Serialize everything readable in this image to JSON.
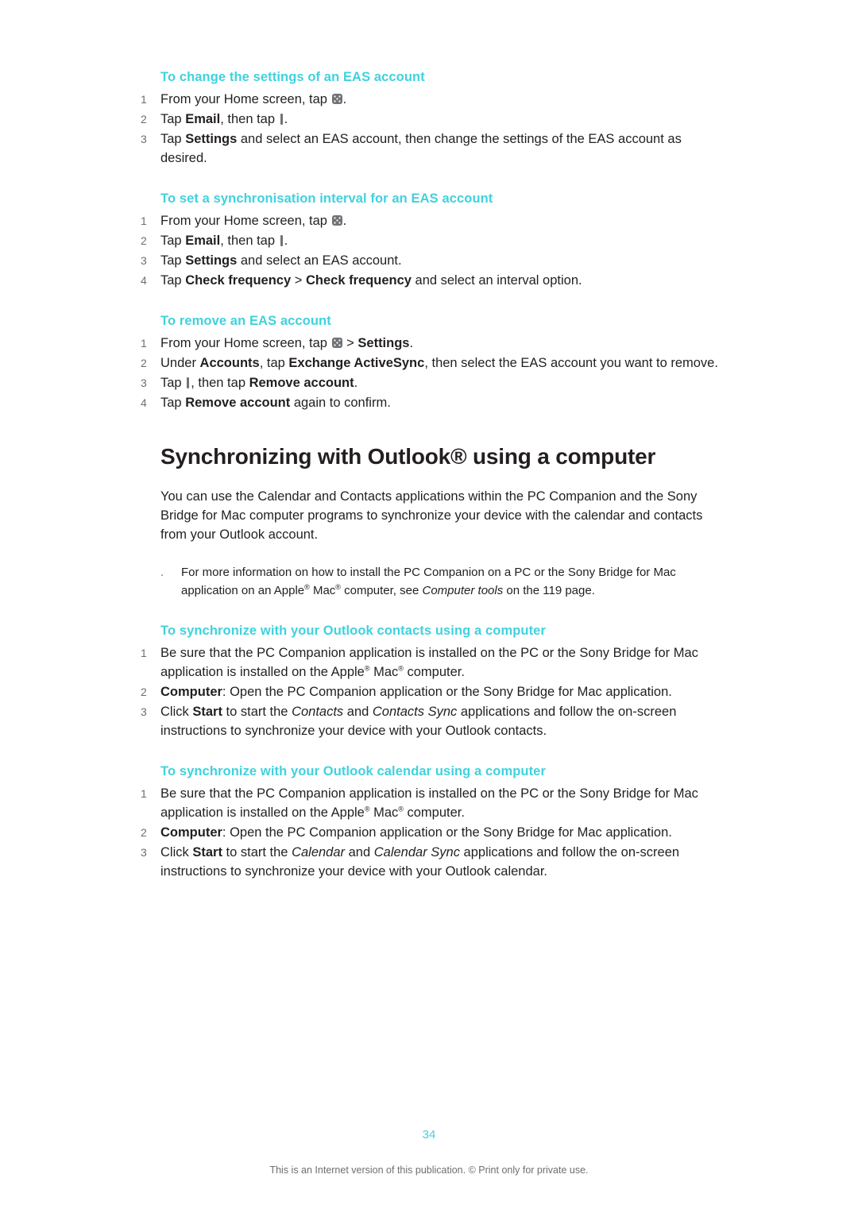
{
  "page": {
    "number": "34",
    "footer": "This is an Internet version of this publication. © Print only for private use."
  },
  "sections": [
    {
      "heading": "To change the settings of an EAS account",
      "steps": [
        {
          "num": "1",
          "html": "From your Home screen, tap <span class=\"icon-apps\" data-name=\"apps-icon\" data-interactable=\"false\"></span>."
        },
        {
          "num": "2",
          "html": "Tap <b>Email</b>, then tap <span class=\"icon-menu\" data-name=\"options-menu-icon\" data-interactable=\"false\"></span>."
        },
        {
          "num": "3",
          "html": "Tap <b>Settings</b> and select an EAS account, then change the settings of the EAS account as desired."
        }
      ]
    },
    {
      "heading": "To set a synchronisation interval for an EAS account",
      "steps": [
        {
          "num": "1",
          "html": "From your Home screen, tap <span class=\"icon-apps\" data-name=\"apps-icon\" data-interactable=\"false\"></span>."
        },
        {
          "num": "2",
          "html": "Tap <b>Email</b>, then tap <span class=\"icon-menu\" data-name=\"options-menu-icon\" data-interactable=\"false\"></span>."
        },
        {
          "num": "3",
          "html": "Tap <b>Settings</b> and select an EAS account."
        },
        {
          "num": "4",
          "html": "Tap <b>Check frequency</b> &gt; <b>Check frequency</b> and select an interval option."
        }
      ]
    },
    {
      "heading": "To remove an EAS account",
      "steps": [
        {
          "num": "1",
          "html": "From your Home screen, tap <span class=\"icon-apps\" data-name=\"apps-icon\" data-interactable=\"false\"></span> &gt; <b>Settings</b>."
        },
        {
          "num": "2",
          "html": "Under <b>Accounts</b>, tap <b>Exchange ActiveSync</b>, then select the EAS account you want to remove."
        },
        {
          "num": "3",
          "html": "Tap <span class=\"icon-menu\" data-name=\"options-menu-icon\" data-interactable=\"false\"></span>, then tap <b>Remove account</b>."
        },
        {
          "num": "4",
          "html": "Tap <b>Remove account</b> again to confirm."
        }
      ]
    }
  ],
  "main": {
    "title": "Synchronizing with Outlook® using a computer",
    "intro": "You can use the Calendar and Contacts applications within the PC Companion and the Sony Bridge for Mac computer programs to synchronize your device with the calendar and contacts from your Outlook account.",
    "note_html": "For more information on how to install the PC Companion on a PC or the Sony Bridge for Mac application on an Apple<sup>®</sup> Mac<sup>®</sup> computer, see <i>Computer tools</i> on the 119 page.",
    "note_bullet": "."
  },
  "sections2": [
    {
      "heading": "To synchronize with your Outlook contacts using a computer",
      "steps": [
        {
          "num": "1",
          "html": "Be sure that the PC Companion application is installed on the PC or the Sony Bridge for Mac application is installed on the Apple<sup>®</sup> Mac<sup>®</sup> computer."
        },
        {
          "num": "2",
          "html": "<b>Computer</b>: Open the PC Companion application or the Sony Bridge for Mac application."
        },
        {
          "num": "3",
          "html": "Click <b>Start</b> to start the <i>Contacts</i> and <i>Contacts Sync</i> applications and follow the on-screen instructions to synchronize your device with your Outlook contacts."
        }
      ]
    },
    {
      "heading": "To synchronize with your Outlook calendar using a computer",
      "steps": [
        {
          "num": "1",
          "html": "Be sure that the PC Companion application is installed on the PC or the Sony Bridge for Mac application is installed on the Apple<sup>®</sup> Mac<sup>®</sup> computer."
        },
        {
          "num": "2",
          "html": "<b>Computer</b>: Open the PC Companion application or the Sony Bridge for Mac application."
        },
        {
          "num": "3",
          "html": "Click <b>Start</b> to start the <i>Calendar</i> and <i>Calendar Sync</i> applications and follow the on-screen instructions to synchronize your device with your Outlook calendar."
        }
      ]
    }
  ],
  "colors": {
    "heading_accent": "#3fd2dd",
    "body_text": "#231f20",
    "muted": "#6d6e71"
  }
}
